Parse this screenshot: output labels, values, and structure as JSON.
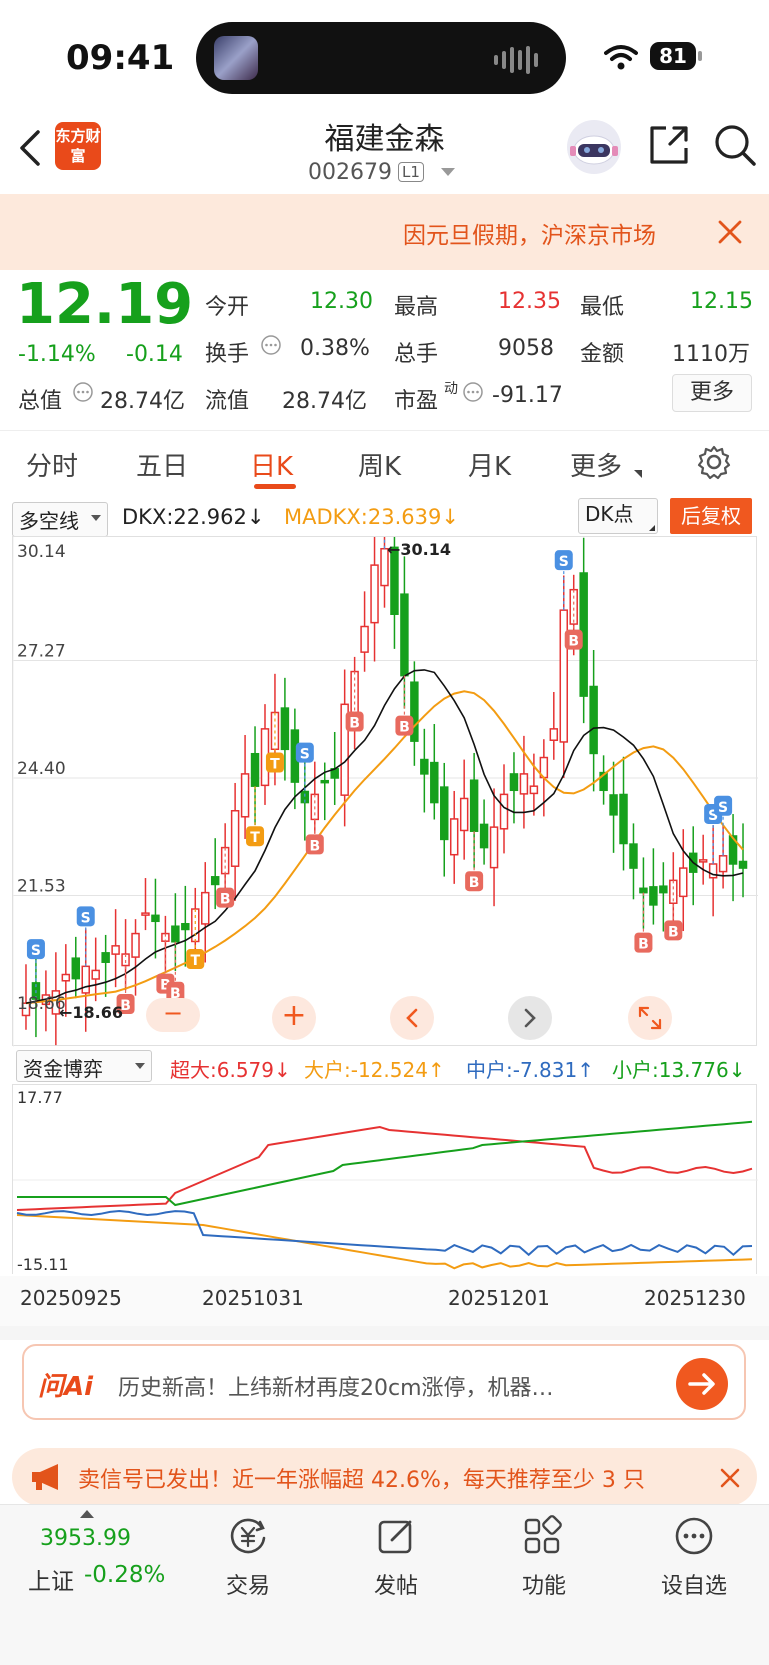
{
  "status_bar": {
    "time": "09:41",
    "battery": "81"
  },
  "header": {
    "brand": "东方财富",
    "title": "福建金森",
    "code": "002679",
    "level": "L1"
  },
  "banner": {
    "text": "因元旦假期，沪深京市场"
  },
  "quote": {
    "price": "12.19",
    "change_pct": "-1.14%",
    "change": "-0.14",
    "open_label": "今开",
    "open": "12.30",
    "high_label": "最高",
    "high": "12.35",
    "low_label": "最低",
    "low": "12.15",
    "turnover_label": "换手",
    "turnover": "0.38%",
    "volume_label": "总手",
    "volume": "9058",
    "amount_label": "金额",
    "amount": "1110万",
    "mktcap_label": "总值",
    "mktcap": "28.74亿",
    "float_label": "流值",
    "float": "28.74亿",
    "pe_label": "市盈",
    "pe_sup": "动",
    "pe": "-91.17",
    "more": "更多"
  },
  "tabs": [
    {
      "label": "分时"
    },
    {
      "label": "五日"
    },
    {
      "label": "日K"
    },
    {
      "label": "周K"
    },
    {
      "label": "月K"
    },
    {
      "label": "更多"
    }
  ],
  "indicator": {
    "select": "多空线",
    "dkx": "DKX:22.962↓",
    "madkx": "MADKX:23.639↓",
    "dk_point": "DK点",
    "adjust": "后复权"
  },
  "kline": {
    "y_ticks": [
      "30.14",
      "27.27",
      "24.40",
      "21.53",
      "18.66"
    ],
    "max_label": "30.14",
    "min_label": "18.66",
    "colors": {
      "up": "#e63232",
      "down": "#16a01c",
      "dkx": "#111111",
      "madkx": "#f39c12"
    }
  },
  "fund": {
    "select": "资金博弈",
    "super": "超大:6.579↓",
    "large": "大户:-12.524↑",
    "mid": "中户:-7.831↑",
    "small": "小户:13.776↓",
    "y_top": "17.77",
    "y_bottom": "-15.11"
  },
  "dates": [
    "20250925",
    "20251031",
    "20251201",
    "20251230"
  ],
  "ai": {
    "logo": "问Ai",
    "text": "历史新高！上纬新材再度20cm涨停，机器…"
  },
  "ad": {
    "text": "卖信号已发出！近一年涨幅超 42.6%，每天推荐至少 3 只"
  },
  "bottom": {
    "index_value": "3953.99",
    "index_name": "上证",
    "index_change": "-0.28%",
    "items": [
      {
        "label": "交易"
      },
      {
        "label": "发帖"
      },
      {
        "label": "功能"
      },
      {
        "label": "设自选"
      }
    ]
  }
}
